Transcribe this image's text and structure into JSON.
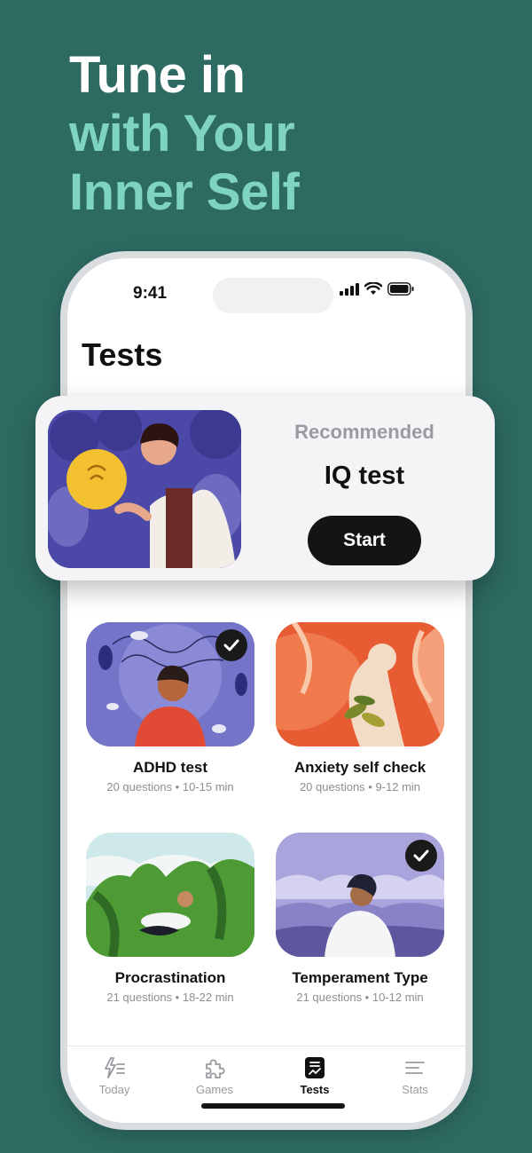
{
  "headline": {
    "line1": "Tune in",
    "line2": "with Your",
    "line3": "Inner Self"
  },
  "status_bar": {
    "time": "9:41"
  },
  "page": {
    "title": "Tests"
  },
  "recommended": {
    "label": "Recommended",
    "title": "IQ test",
    "button": "Start"
  },
  "tests": [
    {
      "title": "ADHD test",
      "meta": "20 questions • 10-15 min",
      "completed": true
    },
    {
      "title": "Anxiety self check",
      "meta": "20 questions • 9-12 min",
      "completed": false
    },
    {
      "title": "Procrastination",
      "meta": "21 questions • 18-22 min",
      "completed": false
    },
    {
      "title": "Temperament Type",
      "meta": "21 questions • 10-12 min",
      "completed": true
    }
  ],
  "tabs": [
    {
      "label": "Today",
      "icon": "lightning-list-icon"
    },
    {
      "label": "Games",
      "icon": "puzzle-icon"
    },
    {
      "label": "Tests",
      "icon": "test-sheet-icon",
      "active": true
    },
    {
      "label": "Stats",
      "icon": "lines-icon"
    }
  ],
  "colors": {
    "background": "#2d6a62",
    "accent": "#7fd4c0",
    "button": "#141416"
  }
}
